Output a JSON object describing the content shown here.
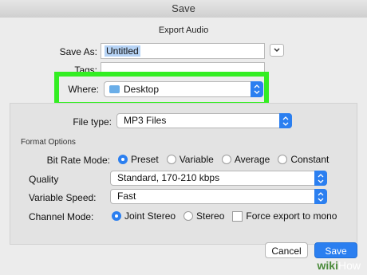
{
  "window": {
    "title": "Save"
  },
  "dialog": {
    "heading": "Export Audio",
    "save_as": {
      "label": "Save As:",
      "value": "Untitled"
    },
    "tags": {
      "label": "Tags:"
    },
    "where": {
      "label": "Where:",
      "value": "Desktop"
    },
    "file_type": {
      "label": "File type:",
      "value": "MP3 Files"
    },
    "format_options": {
      "heading": "Format Options",
      "bit_rate_mode": {
        "label": "Bit Rate Mode:",
        "options": [
          "Preset",
          "Variable",
          "Average",
          "Constant"
        ],
        "selected": "Preset"
      },
      "quality": {
        "label": "Quality",
        "value": "Standard, 170-210 kbps"
      },
      "variable_speed": {
        "label": "Variable Speed:",
        "value": "Fast"
      },
      "channel_mode": {
        "label": "Channel Mode:",
        "options": [
          "Joint Stereo",
          "Stereo"
        ],
        "selected": "Joint Stereo",
        "checkbox": "Force export to mono"
      }
    },
    "buttons": {
      "cancel": "Cancel",
      "save": "Save"
    }
  },
  "watermark": {
    "prefix": "wiki",
    "suffix": "How"
  },
  "colors": {
    "accent": "#2b7ff0",
    "highlight": "#33ee22"
  }
}
